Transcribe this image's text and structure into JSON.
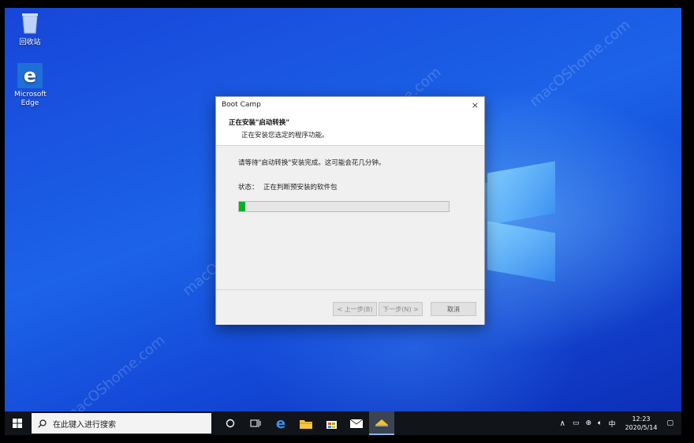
{
  "desktop": {
    "icons": [
      {
        "label": "回收站",
        "icon": "recycle-bin-icon"
      },
      {
        "label": "Microsoft Edge",
        "icon": "edge-icon"
      }
    ],
    "watermark": "macOShome.com"
  },
  "dialog": {
    "title": "Boot Camp",
    "close": "×",
    "header_title": "正在安装\"启动转换\"",
    "header_subtitle": "正在安装您选定的程序功能。",
    "instruction": "请等待\"启动转换\"安装完成。这可能会花几分钟。",
    "status_label": "状态：",
    "status_value": "正在判断预安装的软件包",
    "progress_fraction": 0.03,
    "buttons": {
      "back": "< 上一步(B)",
      "next": "下一步(N) >",
      "cancel": "取消"
    }
  },
  "taskbar": {
    "search_placeholder": "在此键入进行搜索",
    "apps": [
      "task-view-icon",
      "cortana-icon",
      "edge-icon",
      "file-explorer-icon",
      "store-icon",
      "mail-icon",
      "bootcamp-icon"
    ],
    "tray": {
      "ime": "中",
      "time": "12:23",
      "date": "2020/5/14"
    }
  },
  "colors": {
    "progress": "#06b025",
    "taskbar": "#111418",
    "desktop": "#1c63e8"
  }
}
